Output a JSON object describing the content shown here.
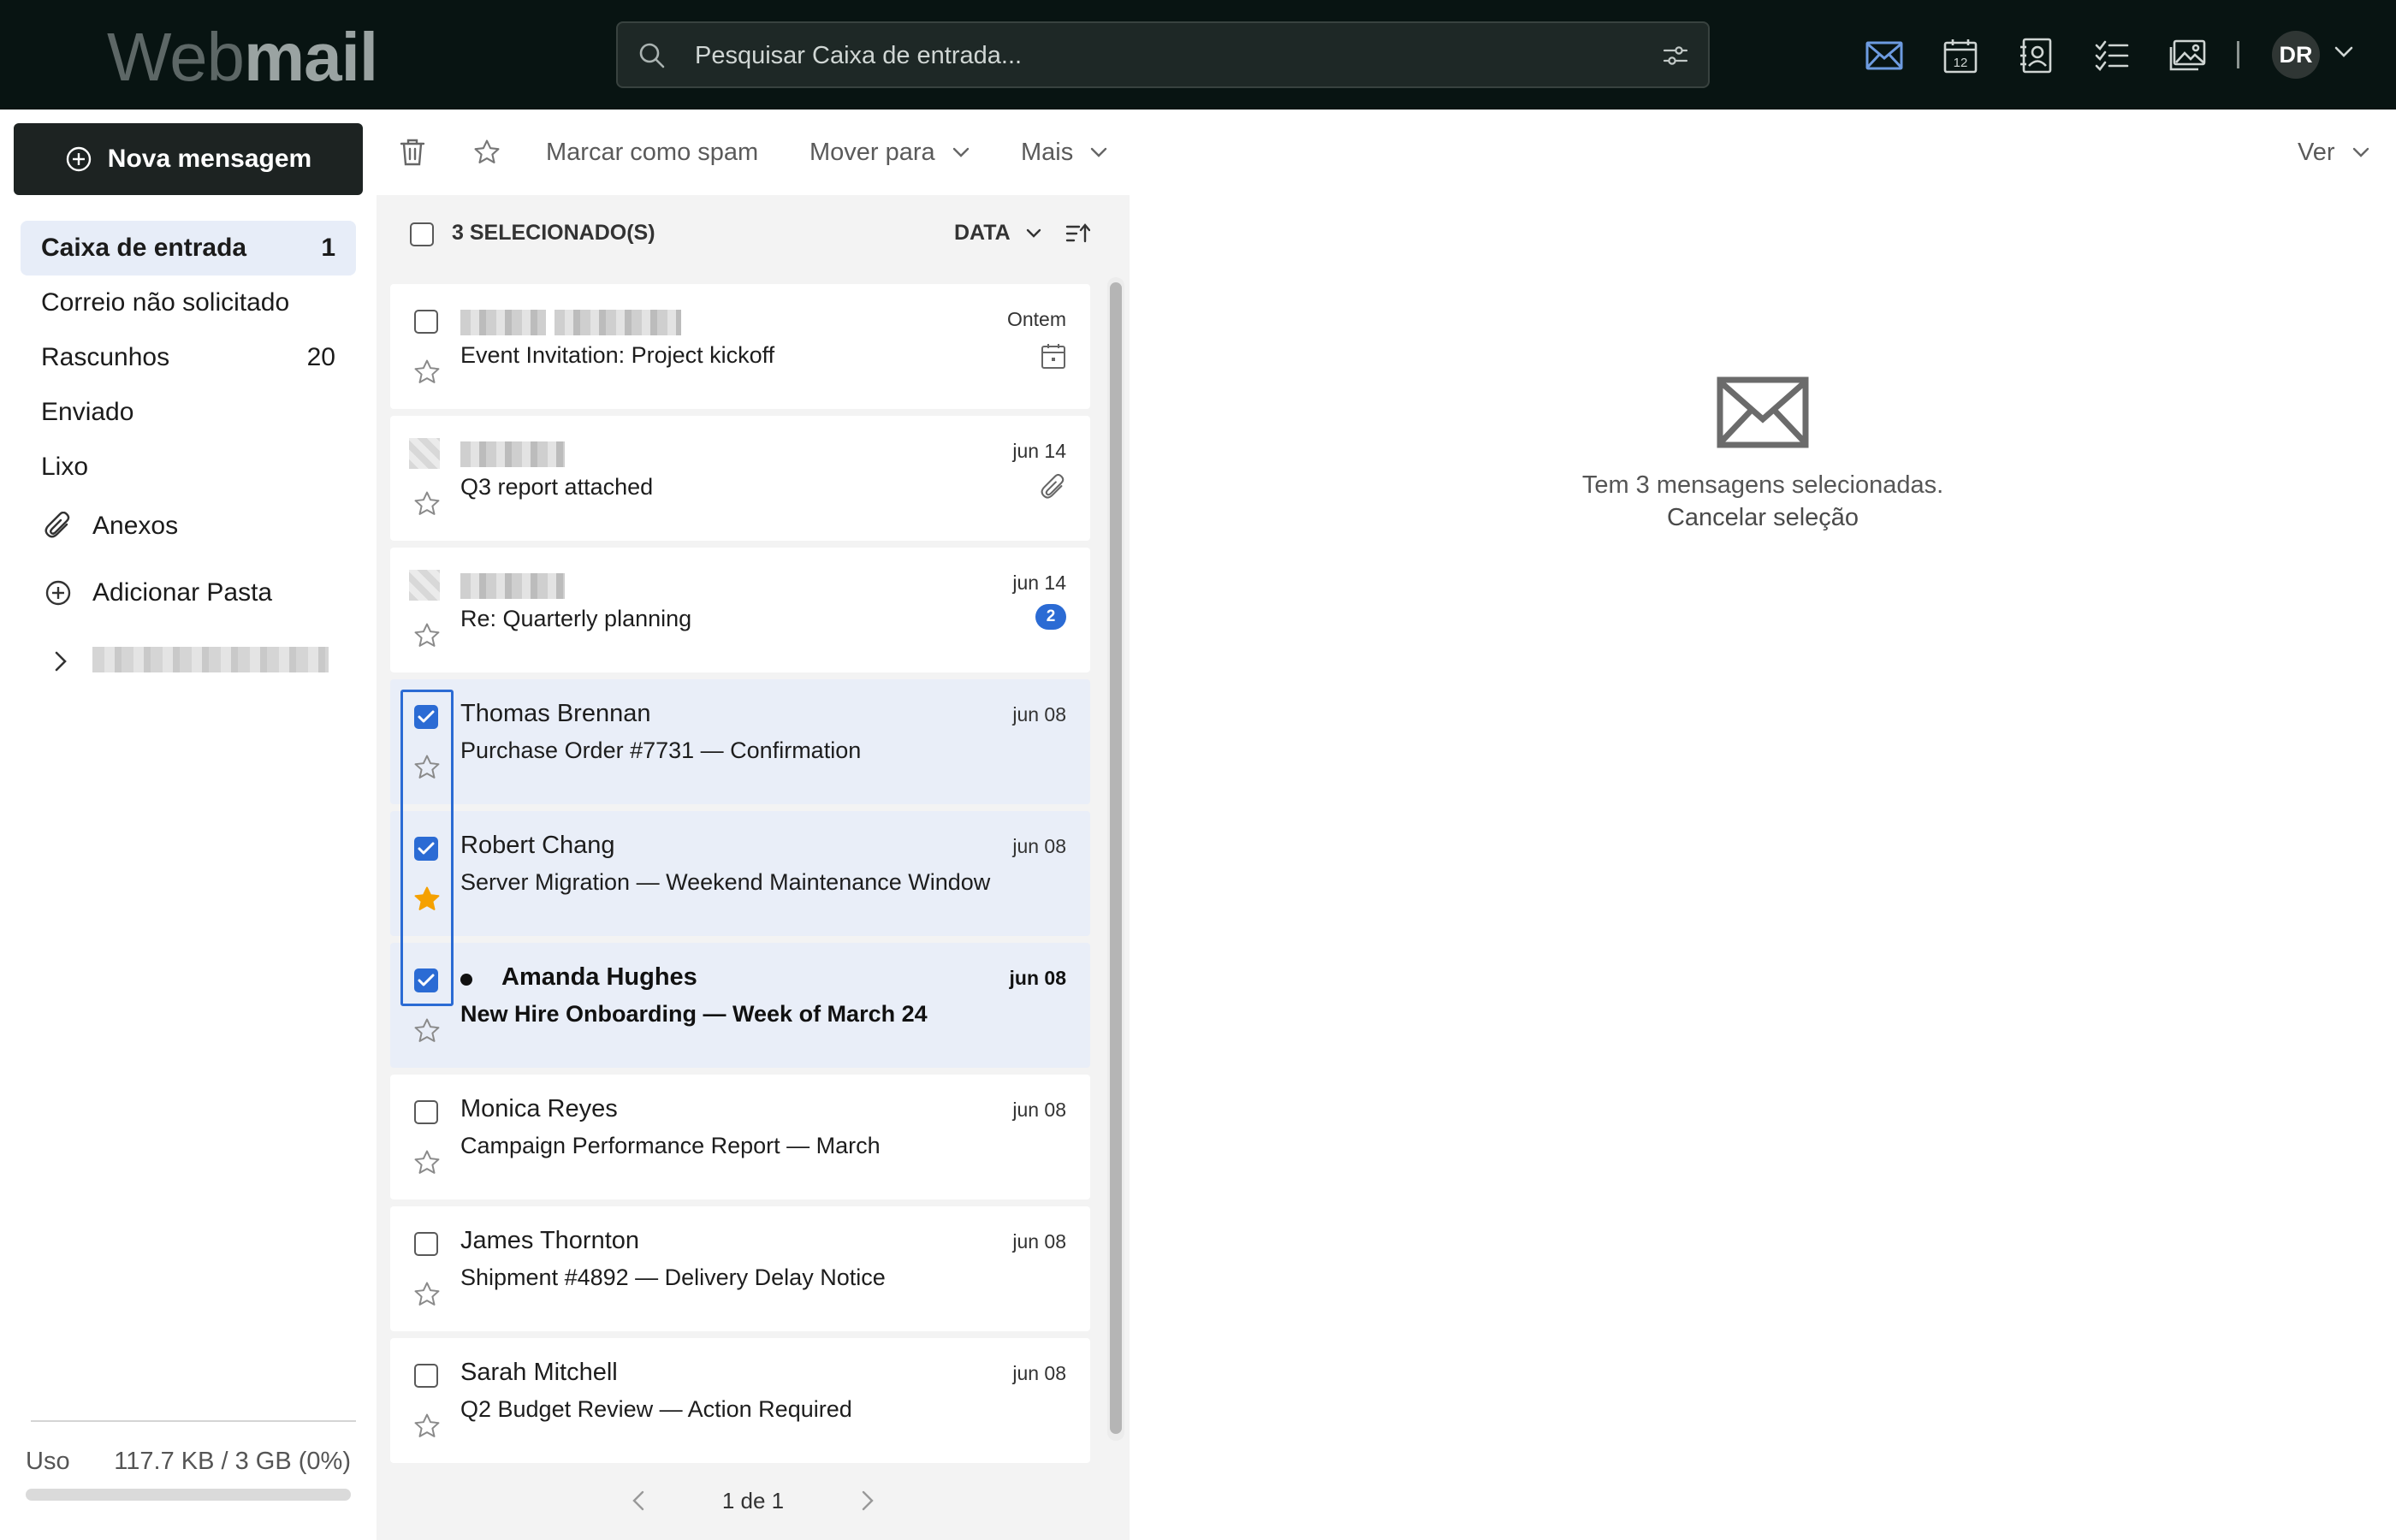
{
  "app": {
    "logo_light": "Web",
    "logo_bold": "mail"
  },
  "search": {
    "placeholder": "Pesquisar Caixa de entrada..."
  },
  "apps": {
    "mail_icon": "mail-icon",
    "calendar_icon": "calendar-icon",
    "calendar_day": "12",
    "contacts_icon": "contacts-icon",
    "tasks_icon": "tasks-icon",
    "photos_icon": "photos-icon",
    "active_color": "#6d9be0"
  },
  "user": {
    "initials": "DR"
  },
  "sidebar": {
    "compose_label": "Nova mensagem",
    "folders": [
      {
        "label": "Caixa de entrada",
        "count": "1",
        "active": true
      },
      {
        "label": "Correio não solicitado",
        "count": ""
      },
      {
        "label": "Rascunhos",
        "count": "20"
      },
      {
        "label": "Enviado",
        "count": ""
      },
      {
        "label": "Lixo",
        "count": ""
      }
    ],
    "attachments_label": "Anexos",
    "add_folder_label": "Adicionar Pasta",
    "storage": {
      "label": "Uso",
      "value": "117.7 KB / 3 GB (0%)",
      "fraction": 0.0
    }
  },
  "toolbar": {
    "spam_label": "Marcar como spam",
    "move_label": "Mover para",
    "more_label": "Mais",
    "view_label": "Ver"
  },
  "list": {
    "selected_label": "3 SELECIONADO(S)",
    "sort_label": "DATA",
    "messages": [
      {
        "sender": "",
        "subject": "Event Invitation: Project kickoff",
        "date": "Ontem",
        "icon": "calendar-icon",
        "selected": false,
        "starred": false
      },
      {
        "sender": "",
        "subject": "Q3 report attached",
        "date": "jun 14",
        "icon": "paperclip-icon",
        "selected": false,
        "starred": false
      },
      {
        "sender": "",
        "subject": "Re: Quarterly planning",
        "date": "jun 14",
        "thread_count": "2",
        "selected": false,
        "starred": false
      },
      {
        "sender": "Thomas Brennan",
        "subject": "Purchase Order #7731 — Confirmation",
        "date": "jun 08",
        "selected": true,
        "starred": false
      },
      {
        "sender": "Robert Chang",
        "subject": "Server Migration — Weekend Maintenance Window",
        "date": "jun 08",
        "selected": true,
        "starred": true
      },
      {
        "sender": "Amanda Hughes",
        "subject": "New Hire Onboarding — Week of March 24",
        "date": "jun 08",
        "selected": true,
        "starred": false,
        "unread": true
      },
      {
        "sender": "Monica Reyes",
        "subject": "Campaign Performance Report — March",
        "date": "jun 08",
        "selected": false,
        "starred": false
      },
      {
        "sender": "James Thornton",
        "subject": "Shipment #4892 — Delivery Delay Notice",
        "date": "jun 08",
        "selected": false,
        "starred": false
      },
      {
        "sender": "Sarah Mitchell",
        "subject": "Q2 Budget Review — Action Required",
        "date": "jun 08",
        "selected": false,
        "starred": false
      }
    ],
    "pager": "1 de 1"
  },
  "reading_pane": {
    "message": "Tem 3 mensagens selecionadas.",
    "cancel_label": "Cancelar seleção"
  },
  "colors": {
    "accent": "#2b6bd4",
    "star": "#f5a100",
    "topbar": "#081412",
    "selected_row": "#e9eef8"
  }
}
